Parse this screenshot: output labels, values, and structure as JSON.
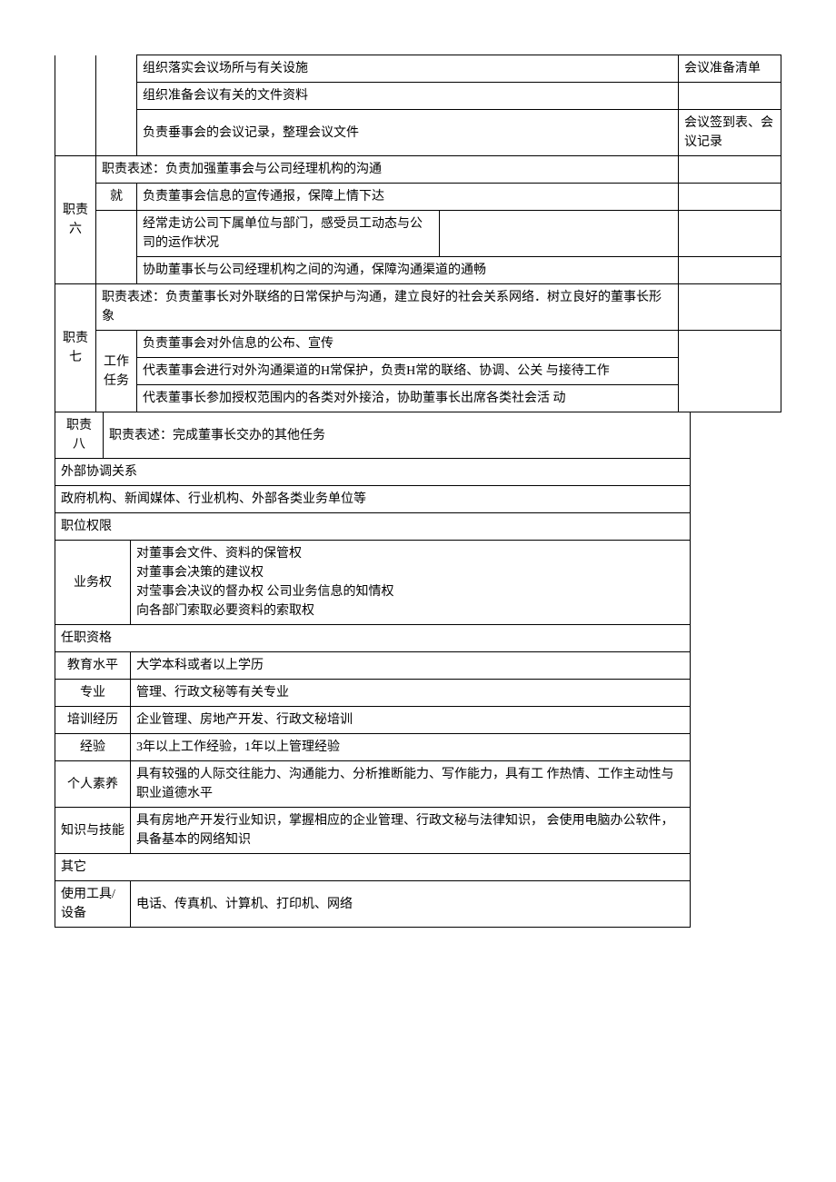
{
  "section_top": {
    "rows": [
      {
        "task": "组织落实会议场所与有关设施",
        "output": "会议准备清单"
      },
      {
        "task": "组织准备会议有关的文件资料",
        "output": ""
      },
      {
        "task": "负责垂事会的会议记录，整理会议文件",
        "output": "会议签到表、会议记录"
      }
    ]
  },
  "duty6": {
    "label": "职责六",
    "desc": "职责表述：负责加强董事会与公司经理机构的沟通",
    "desc2_prefix": "就",
    "desc2": "负责董事会信息的宣传通报，保障上情下达",
    "tasks": [
      "经常走访公司下属单位与部门，感受员工动态与公司的运作状况",
      "协助董事长与公司经理机构之间的沟通，保障沟通渠道的通畅"
    ]
  },
  "duty7": {
    "label": "职责七",
    "desc": "职责表述：负责董事长对外联络的日常保护与沟通，建立良好的社会关系网络．树立良好的董事长形象",
    "tasks_label": "工作任务",
    "tasks": [
      "负责董事会对外信息的公布、宣传",
      "代表董事会进行对外沟通渠道的H常保护，负责H常的联络、协调、公关 与接待工作",
      "代表董事长参加授权范围内的各类对外接洽，协助董事长出席各类社会活 动"
    ]
  },
  "duty8": {
    "label": "职责八",
    "desc": "职责表述：完成董事长交办的其他任务"
  },
  "external": {
    "header": "外部协调关系",
    "content": "政府机构、新闻媒体、行业机构、外部各类业务单位等"
  },
  "authority": {
    "header": "职位权限",
    "label": "业务权",
    "lines": [
      "对董事会文件、资料的保管权",
      "对董事会决策的建议权",
      "对莹事会决议的督办权 公司业务信息的知情权",
      "向各部门索取必要资料的索取权"
    ]
  },
  "qualification": {
    "header": "任职资格",
    "rows": [
      {
        "label": "教育水平",
        "content": "大学本科或者以上学历"
      },
      {
        "label": "专业",
        "content": "管理、行政文秘等有关专业"
      },
      {
        "label": "培训经历",
        "content": "企业管理、房地产开发、行政文秘培训"
      },
      {
        "label": "经验",
        "content": "3年以上工作经验，1年以上管理经验"
      },
      {
        "label": "个人素养",
        "content": "具有较强的人际交往能力、沟通能力、分析推断能力、写作能力，具有工 作热情、工作主动性与职业道德水平"
      },
      {
        "label": "知识与技能",
        "content": "具有房地产开发行业知识，掌握相应的企业管理、行政文秘与法律知识， 会使用电脑办公软件，具备基本的网络知识"
      }
    ]
  },
  "other": {
    "header": "其它",
    "label": "使用工具/设备",
    "content": "电话、传真机、计算机、打印机、网络"
  }
}
